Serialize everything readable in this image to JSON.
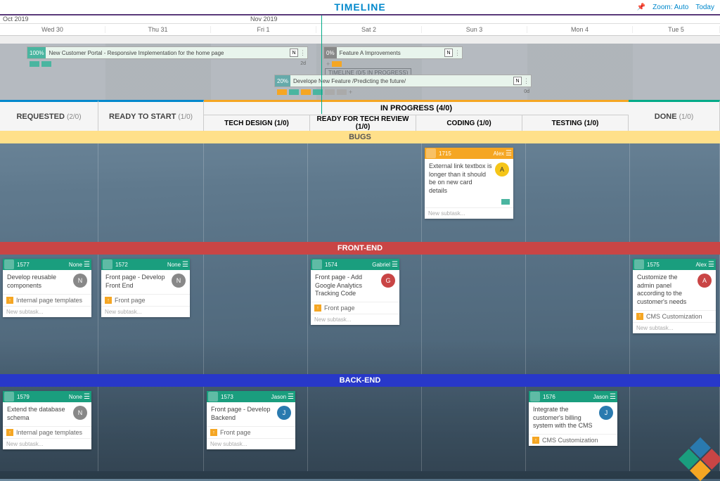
{
  "header": {
    "title": "TIMELINE",
    "zoom": "Zoom: Auto",
    "today": "Today"
  },
  "timeline": {
    "months": {
      "oct": "Oct 2019",
      "nov": "Nov 2019"
    },
    "days": [
      "Wed 30",
      "Thu 31",
      "Fri 1",
      "Sat 2",
      "Sun 3",
      "Mon 4",
      "Tue 5"
    ],
    "badge": "TIMELINE (0/5 IN PROGRESS)",
    "bars": [
      {
        "pct": "100%",
        "title": "New Customer Portal - Responsive Implementation for the home page",
        "letter": "N",
        "dur": "2d"
      },
      {
        "pct": "0%",
        "title": "Feature A Improvements",
        "letter": "N",
        "dur": ""
      },
      {
        "pct": "20%",
        "title": "Develope New Feature /Predicting the future/",
        "letter": "N",
        "dur": "0d"
      }
    ]
  },
  "columns": {
    "requested": {
      "label": "REQUESTED",
      "count": "(2/0)"
    },
    "ready": {
      "label": "READY TO START",
      "count": "(1/0)"
    },
    "inprogress": {
      "label": "IN PROGRESS",
      "count": "(4/0)"
    },
    "tech_design": {
      "label": "TECH DESIGN",
      "count": "(1/0)"
    },
    "ready_review": {
      "label": "READY FOR TECH REVIEW",
      "count": "(1/0)"
    },
    "coding": {
      "label": "CODING",
      "count": "(1/0)"
    },
    "testing": {
      "label": "TESTING",
      "count": "(1/0)"
    },
    "done": {
      "label": "DONE",
      "count": "(1/0)"
    }
  },
  "swimlanes": {
    "bugs": "BUGS",
    "front": "FRONT-END",
    "back": "BACK-END"
  },
  "new_subtask": "New subtask...",
  "cards": {
    "c1715": {
      "id": "1715",
      "assignee": "Alex",
      "title": "External link textbox is longer than it should be on new card details"
    },
    "c1577": {
      "id": "1577",
      "assignee": "None",
      "title": "Develop reusable components",
      "tag": "Internal page templates"
    },
    "c1572": {
      "id": "1572",
      "assignee": "None",
      "title": "Front page - Develop Front End",
      "tag": "Front page"
    },
    "c1574": {
      "id": "1574",
      "assignee": "Gabriel",
      "title": "Front page - Add Google Analytics Tracking Code",
      "tag": "Front page"
    },
    "c1575": {
      "id": "1575",
      "assignee": "Alex",
      "title": "Customize the admin panel according to the customer's needs",
      "tag": "CMS Customization"
    },
    "c1579": {
      "id": "1579",
      "assignee": "None",
      "title": "Extend the database schema",
      "tag": "Internal page templates"
    },
    "c1573": {
      "id": "1573",
      "assignee": "Jason",
      "title": "Front page - Develop Backend",
      "tag": "Front page"
    },
    "c1576": {
      "id": "1576",
      "assignee": "Jason",
      "title": "Integrate the customer's billing system with the CMS",
      "tag": "CMS Customization"
    }
  }
}
